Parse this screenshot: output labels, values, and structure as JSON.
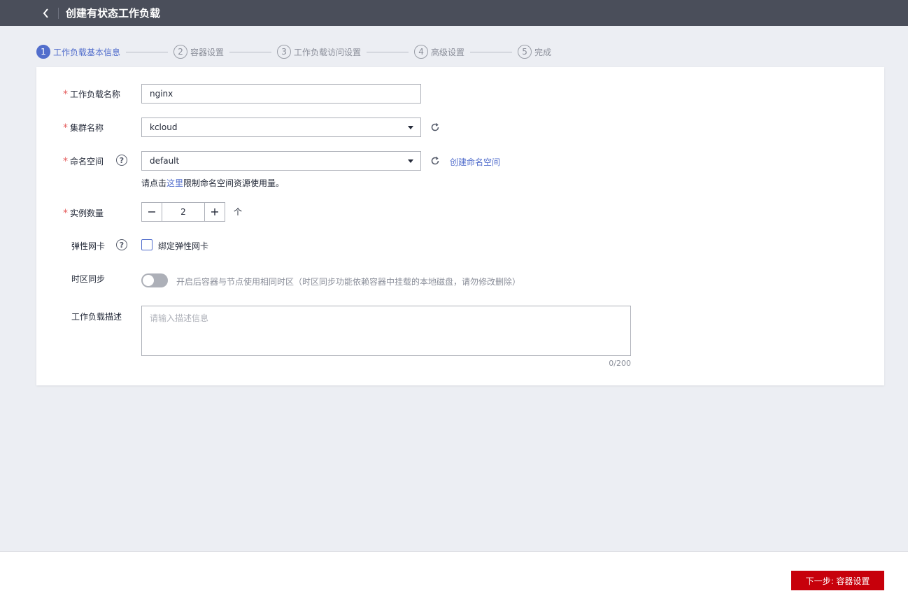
{
  "header": {
    "title": "创建有状态工作负载"
  },
  "steps": [
    {
      "num": "1",
      "label": "工作负载基本信息",
      "active": true
    },
    {
      "num": "2",
      "label": "容器设置"
    },
    {
      "num": "3",
      "label": "工作负载访问设置"
    },
    {
      "num": "4",
      "label": "高级设置"
    },
    {
      "num": "5",
      "label": "完成"
    }
  ],
  "form": {
    "workload_name": {
      "label": "工作负载名称",
      "value": "nginx"
    },
    "cluster": {
      "label": "集群名称",
      "value": "kcloud"
    },
    "namespace": {
      "label": "命名空间",
      "value": "default",
      "create_link": "创建命名空间",
      "hint_prefix": "请点击",
      "hint_link": "这里",
      "hint_suffix": "限制命名空间资源使用量。"
    },
    "instances": {
      "label": "实例数量",
      "value": "2",
      "unit": "个"
    },
    "eni": {
      "label": "弹性网卡",
      "checkbox_label": "绑定弹性网卡",
      "checked": false
    },
    "timezone": {
      "label": "时区同步",
      "description": "开启后容器与节点使用相同时区（时区同步功能依赖容器中挂载的本地磁盘，请勿修改删除）",
      "enabled": false
    },
    "description": {
      "label": "工作负载描述",
      "placeholder": "请输入描述信息",
      "counter": "0/200"
    }
  },
  "footer": {
    "next_label": "下一步: 容器设置"
  },
  "colors": {
    "primary": "#526ecc",
    "danger": "#c7000b",
    "header_bg": "#4a4e5a"
  }
}
